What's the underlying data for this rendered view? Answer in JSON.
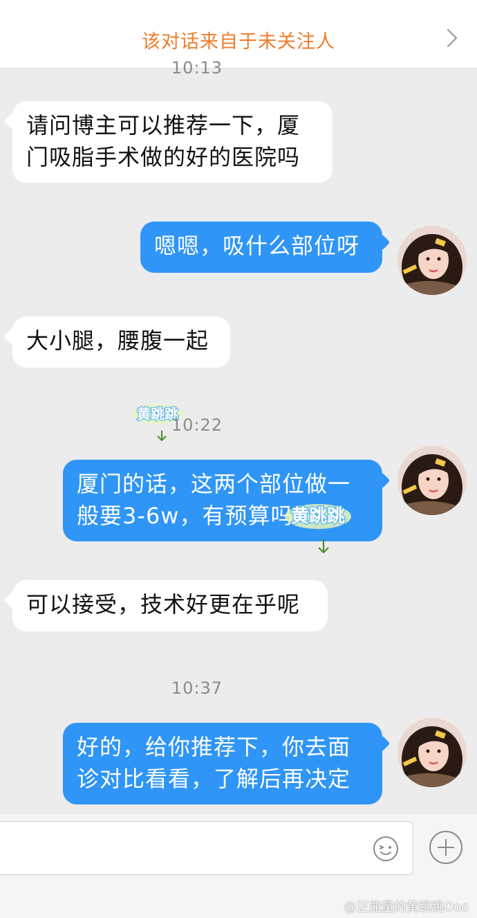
{
  "banner": {
    "text": "该对话来自于未关注人",
    "accent_color": "#ef7c2b",
    "chevron_icon": "chevron-right-icon"
  },
  "timestamps": [
    "10:13",
    "10:22",
    "10:37"
  ],
  "messages": [
    {
      "side": "in",
      "text": "请问博主可以推荐一下，厦\n门吸脂手术做的好的医院吗"
    },
    {
      "side": "out",
      "text": "嗯嗯，吸什么部位呀"
    },
    {
      "side": "in",
      "text": "大小腿，腰腹一起"
    },
    {
      "side": "out",
      "text": "厦门的话，这两个部位做一\n般要3-6w，有预算吗"
    },
    {
      "side": "in",
      "text": "可以接受，技术好更在乎呢"
    },
    {
      "side": "out",
      "text": "好的，给你推荐下，你去面\n诊对比看看，了解后再决定"
    }
  ],
  "colors": {
    "outgoing_bubble": "#2f95f7",
    "incoming_bubble": "#ffffff",
    "background": "#ececec"
  },
  "sticker_text": "黄跳跳",
  "input": {
    "value": "",
    "emoji_icon": "emoji-icon",
    "plus_icon": "plus-icon"
  },
  "footer_watermark": "@正能量的黄跳跳Ooo"
}
